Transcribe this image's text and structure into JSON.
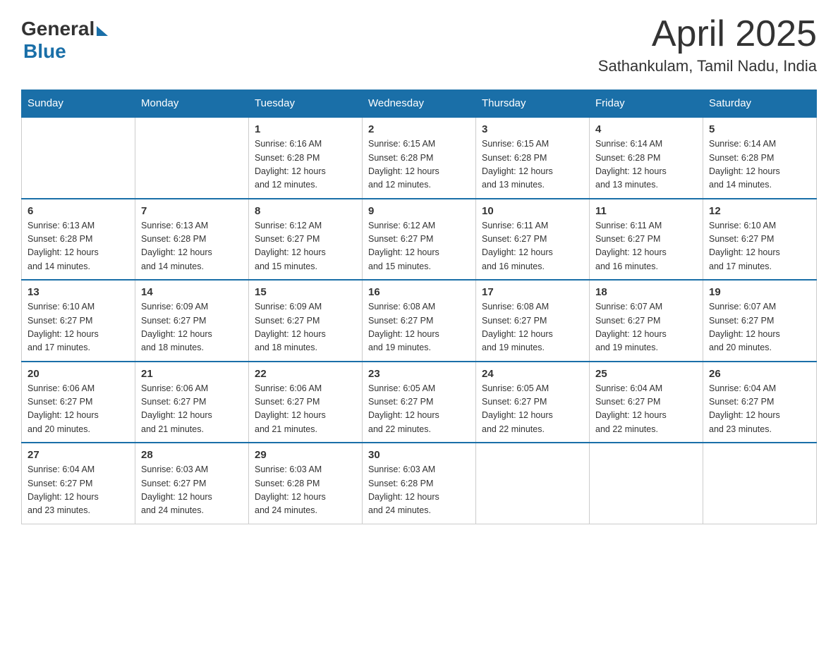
{
  "logo": {
    "general": "General",
    "blue": "Blue"
  },
  "title": "April 2025",
  "location": "Sathankulam, Tamil Nadu, India",
  "headers": [
    "Sunday",
    "Monday",
    "Tuesday",
    "Wednesday",
    "Thursday",
    "Friday",
    "Saturday"
  ],
  "weeks": [
    [
      {
        "day": "",
        "info": ""
      },
      {
        "day": "",
        "info": ""
      },
      {
        "day": "1",
        "info": "Sunrise: 6:16 AM\nSunset: 6:28 PM\nDaylight: 12 hours\nand 12 minutes."
      },
      {
        "day": "2",
        "info": "Sunrise: 6:15 AM\nSunset: 6:28 PM\nDaylight: 12 hours\nand 12 minutes."
      },
      {
        "day": "3",
        "info": "Sunrise: 6:15 AM\nSunset: 6:28 PM\nDaylight: 12 hours\nand 13 minutes."
      },
      {
        "day": "4",
        "info": "Sunrise: 6:14 AM\nSunset: 6:28 PM\nDaylight: 12 hours\nand 13 minutes."
      },
      {
        "day": "5",
        "info": "Sunrise: 6:14 AM\nSunset: 6:28 PM\nDaylight: 12 hours\nand 14 minutes."
      }
    ],
    [
      {
        "day": "6",
        "info": "Sunrise: 6:13 AM\nSunset: 6:28 PM\nDaylight: 12 hours\nand 14 minutes."
      },
      {
        "day": "7",
        "info": "Sunrise: 6:13 AM\nSunset: 6:28 PM\nDaylight: 12 hours\nand 14 minutes."
      },
      {
        "day": "8",
        "info": "Sunrise: 6:12 AM\nSunset: 6:27 PM\nDaylight: 12 hours\nand 15 minutes."
      },
      {
        "day": "9",
        "info": "Sunrise: 6:12 AM\nSunset: 6:27 PM\nDaylight: 12 hours\nand 15 minutes."
      },
      {
        "day": "10",
        "info": "Sunrise: 6:11 AM\nSunset: 6:27 PM\nDaylight: 12 hours\nand 16 minutes."
      },
      {
        "day": "11",
        "info": "Sunrise: 6:11 AM\nSunset: 6:27 PM\nDaylight: 12 hours\nand 16 minutes."
      },
      {
        "day": "12",
        "info": "Sunrise: 6:10 AM\nSunset: 6:27 PM\nDaylight: 12 hours\nand 17 minutes."
      }
    ],
    [
      {
        "day": "13",
        "info": "Sunrise: 6:10 AM\nSunset: 6:27 PM\nDaylight: 12 hours\nand 17 minutes."
      },
      {
        "day": "14",
        "info": "Sunrise: 6:09 AM\nSunset: 6:27 PM\nDaylight: 12 hours\nand 18 minutes."
      },
      {
        "day": "15",
        "info": "Sunrise: 6:09 AM\nSunset: 6:27 PM\nDaylight: 12 hours\nand 18 minutes."
      },
      {
        "day": "16",
        "info": "Sunrise: 6:08 AM\nSunset: 6:27 PM\nDaylight: 12 hours\nand 19 minutes."
      },
      {
        "day": "17",
        "info": "Sunrise: 6:08 AM\nSunset: 6:27 PM\nDaylight: 12 hours\nand 19 minutes."
      },
      {
        "day": "18",
        "info": "Sunrise: 6:07 AM\nSunset: 6:27 PM\nDaylight: 12 hours\nand 19 minutes."
      },
      {
        "day": "19",
        "info": "Sunrise: 6:07 AM\nSunset: 6:27 PM\nDaylight: 12 hours\nand 20 minutes."
      }
    ],
    [
      {
        "day": "20",
        "info": "Sunrise: 6:06 AM\nSunset: 6:27 PM\nDaylight: 12 hours\nand 20 minutes."
      },
      {
        "day": "21",
        "info": "Sunrise: 6:06 AM\nSunset: 6:27 PM\nDaylight: 12 hours\nand 21 minutes."
      },
      {
        "day": "22",
        "info": "Sunrise: 6:06 AM\nSunset: 6:27 PM\nDaylight: 12 hours\nand 21 minutes."
      },
      {
        "day": "23",
        "info": "Sunrise: 6:05 AM\nSunset: 6:27 PM\nDaylight: 12 hours\nand 22 minutes."
      },
      {
        "day": "24",
        "info": "Sunrise: 6:05 AM\nSunset: 6:27 PM\nDaylight: 12 hours\nand 22 minutes."
      },
      {
        "day": "25",
        "info": "Sunrise: 6:04 AM\nSunset: 6:27 PM\nDaylight: 12 hours\nand 22 minutes."
      },
      {
        "day": "26",
        "info": "Sunrise: 6:04 AM\nSunset: 6:27 PM\nDaylight: 12 hours\nand 23 minutes."
      }
    ],
    [
      {
        "day": "27",
        "info": "Sunrise: 6:04 AM\nSunset: 6:27 PM\nDaylight: 12 hours\nand 23 minutes."
      },
      {
        "day": "28",
        "info": "Sunrise: 6:03 AM\nSunset: 6:27 PM\nDaylight: 12 hours\nand 24 minutes."
      },
      {
        "day": "29",
        "info": "Sunrise: 6:03 AM\nSunset: 6:28 PM\nDaylight: 12 hours\nand 24 minutes."
      },
      {
        "day": "30",
        "info": "Sunrise: 6:03 AM\nSunset: 6:28 PM\nDaylight: 12 hours\nand 24 minutes."
      },
      {
        "day": "",
        "info": ""
      },
      {
        "day": "",
        "info": ""
      },
      {
        "day": "",
        "info": ""
      }
    ]
  ]
}
